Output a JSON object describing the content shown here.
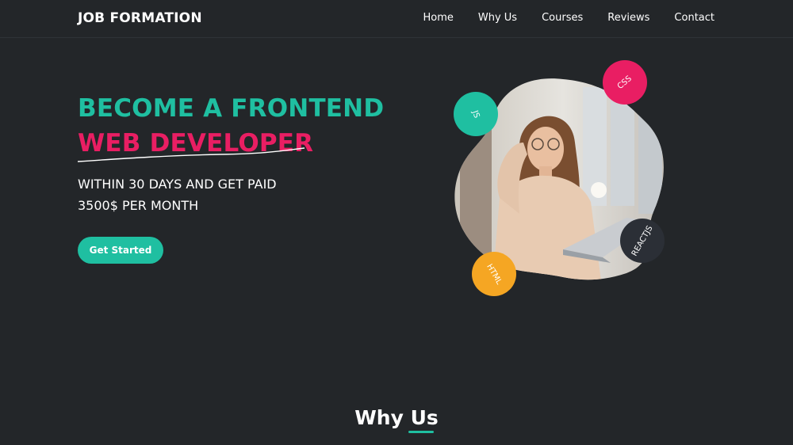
{
  "nav": {
    "brand": "JOB FORMATION",
    "links": [
      "Home",
      "Why Us",
      "Courses",
      "Reviews",
      "Contact"
    ]
  },
  "hero": {
    "line1": "BECOME A FRONTEND",
    "line2": "WEB DEVELOPER",
    "subtitle_1": "WITHIN 30 DAYS AND GET PAID",
    "subtitle_2": "3500$ PER MONTH",
    "cta_label": "Get Started",
    "badges": [
      {
        "label": "CSS",
        "color": "#e91e63"
      },
      {
        "label": "JS",
        "color": "#1fbfa1"
      },
      {
        "label": "REACTJS",
        "color": "#2b2f36"
      },
      {
        "label": "HTML",
        "color": "#f5a623"
      }
    ]
  },
  "section": {
    "title": "Why Us"
  },
  "colors": {
    "accent": "#1fbfa1",
    "pink": "#e91e63",
    "bg": "#232629"
  }
}
